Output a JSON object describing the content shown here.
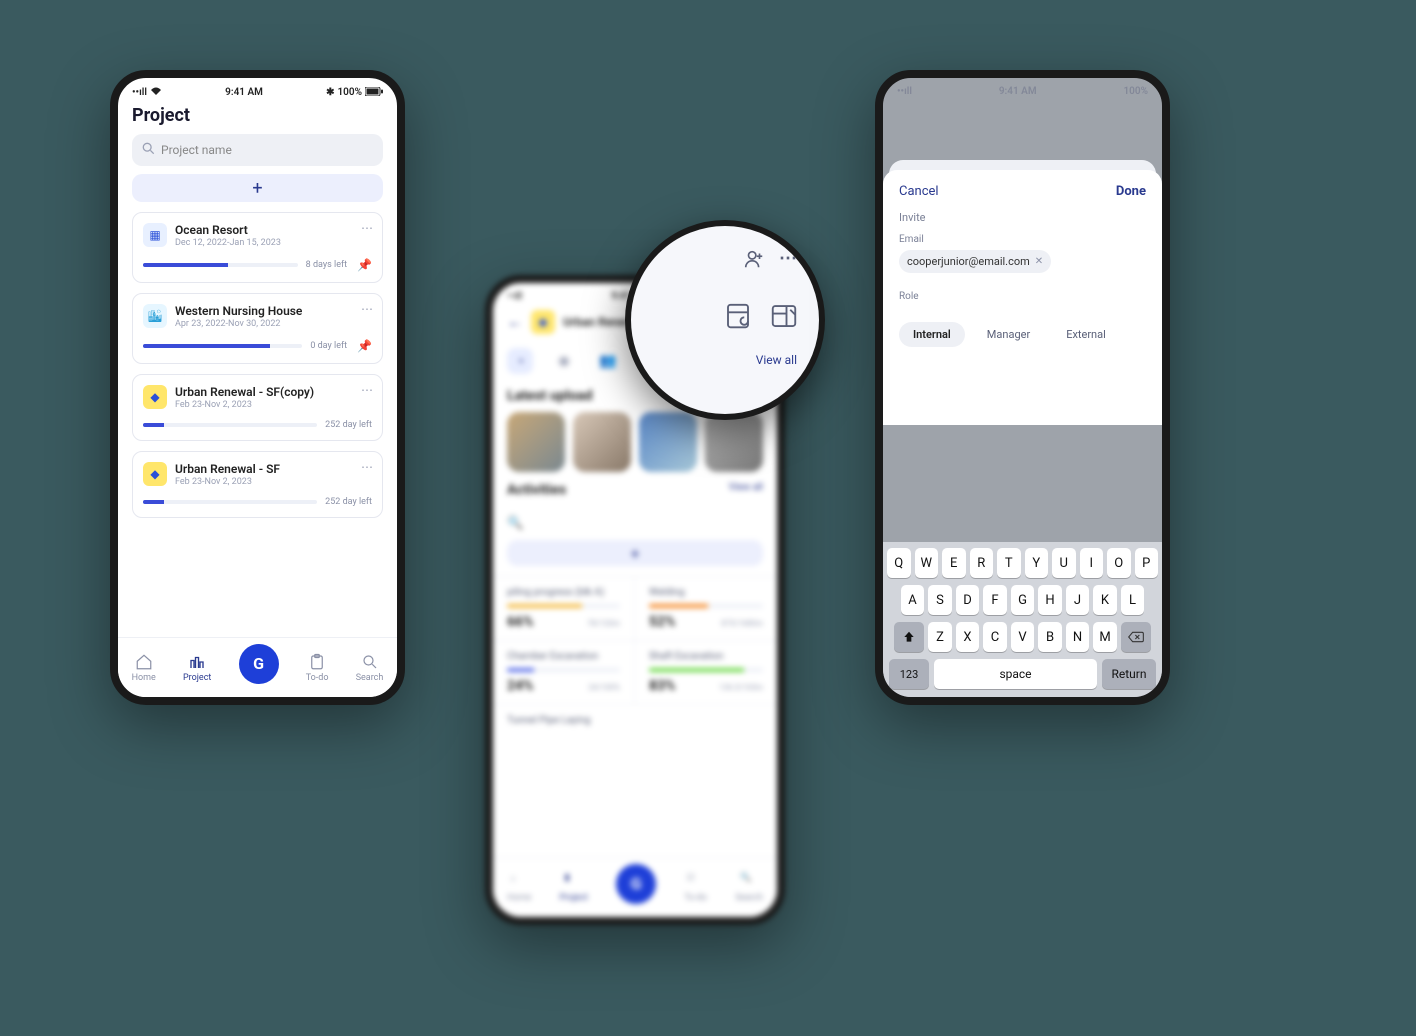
{
  "status": {
    "carrier_signal": "••ıll",
    "wifi": "⌃",
    "time": "9:41 AM",
    "bt": "✱",
    "battery_text": "100%"
  },
  "projects_screen": {
    "title": "Project",
    "search_placeholder": "Project name",
    "add_label": "+",
    "cards": [
      {
        "name": "Ocean Resort",
        "dates": "Dec 12, 2022-Jan 15, 2023",
        "days": "8 days left",
        "progress": 55,
        "pinned": true,
        "icon": "brick"
      },
      {
        "name": "Western Nursing House",
        "dates": "Apr 23, 2022-Nov 30, 2022",
        "days": "0 day left",
        "progress": 80,
        "pinned": true,
        "icon": "city"
      },
      {
        "name": "Urban Renewal - SF(copy)",
        "dates": "Feb 23-Nov 2, 2023",
        "days": "252 day left",
        "progress": 12,
        "pinned": false,
        "icon": "diamond"
      },
      {
        "name": "Urban Renewal - SF",
        "dates": "Feb 23-Nov 2, 2023",
        "days": "252 day left",
        "progress": 12,
        "pinned": false,
        "icon": "diamond"
      }
    ],
    "nav": {
      "home": "Home",
      "project": "Project",
      "center": "G",
      "todo": "To-do",
      "search": "Search"
    }
  },
  "detail_screen": {
    "project_name": "Urban Renewal - SF",
    "tab_active": "Progress",
    "latest_upload_label": "Latest upload",
    "view_all": "View all",
    "activities_label": "Activities",
    "activities": [
      {
        "name": "piling progress (blk A)",
        "pct": "66%",
        "note": "78/120m",
        "fill": 66,
        "color": "#f3b93f"
      },
      {
        "name": "Welding",
        "pct": "52%",
        "note": "875/1680m",
        "fill": 52,
        "color": "#f58a2a"
      },
      {
        "name": "Chamber Excavation",
        "pct": "24%",
        "note": "24/100%",
        "fill": 24,
        "color": "#5a6ee8"
      },
      {
        "name": "Shaft Excavation",
        "pct": "83%",
        "note": "136.5/165m",
        "fill": 83,
        "color": "#6ad845"
      }
    ],
    "last_activity": "Tunnel Pipe Laying"
  },
  "zoom": {
    "view_all": "View all"
  },
  "invite_screen": {
    "cancel": "Cancel",
    "done": "Done",
    "title": "Invite",
    "email_label": "Email",
    "email_value": "cooperjunior@email.com",
    "role_label": "Role",
    "roles": [
      "Internal",
      "Manager",
      "External"
    ],
    "role_selected": "Internal"
  },
  "keyboard": {
    "row1": [
      "Q",
      "W",
      "E",
      "R",
      "T",
      "Y",
      "U",
      "I",
      "O",
      "P"
    ],
    "row2": [
      "A",
      "S",
      "D",
      "F",
      "G",
      "H",
      "J",
      "K",
      "L"
    ],
    "row3": [
      "Z",
      "X",
      "C",
      "V",
      "B",
      "N",
      "M"
    ],
    "num": "123",
    "space": "space",
    "return": "Return"
  }
}
